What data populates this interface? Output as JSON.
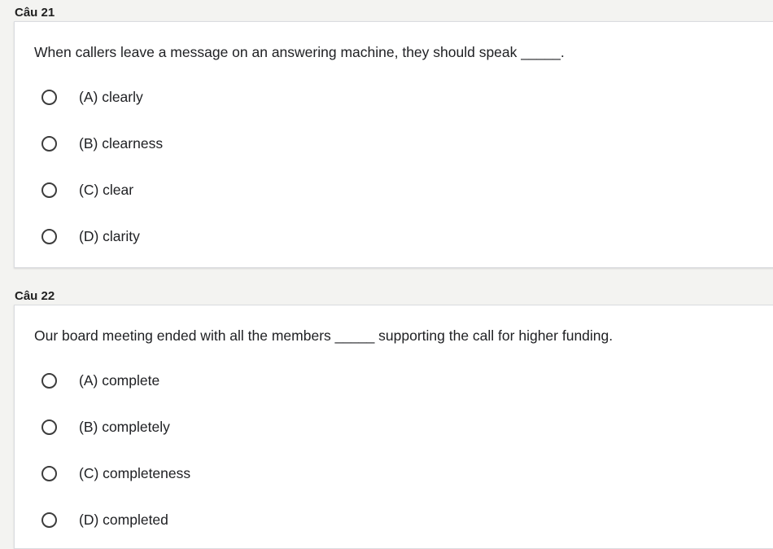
{
  "questions": [
    {
      "label": "Câu 21",
      "text": "When callers leave a message on an answering machine, they should speak _____.",
      "options": [
        "(A) clearly",
        "(B) clearness",
        "(C) clear",
        "(D) clarity"
      ]
    },
    {
      "label": "Câu 22",
      "text": "Our board meeting ended with all the members _____ supporting the call for higher funding.",
      "options": [
        "(A) complete",
        "(B) completely",
        "(C) completeness",
        "(D) completed"
      ]
    }
  ]
}
